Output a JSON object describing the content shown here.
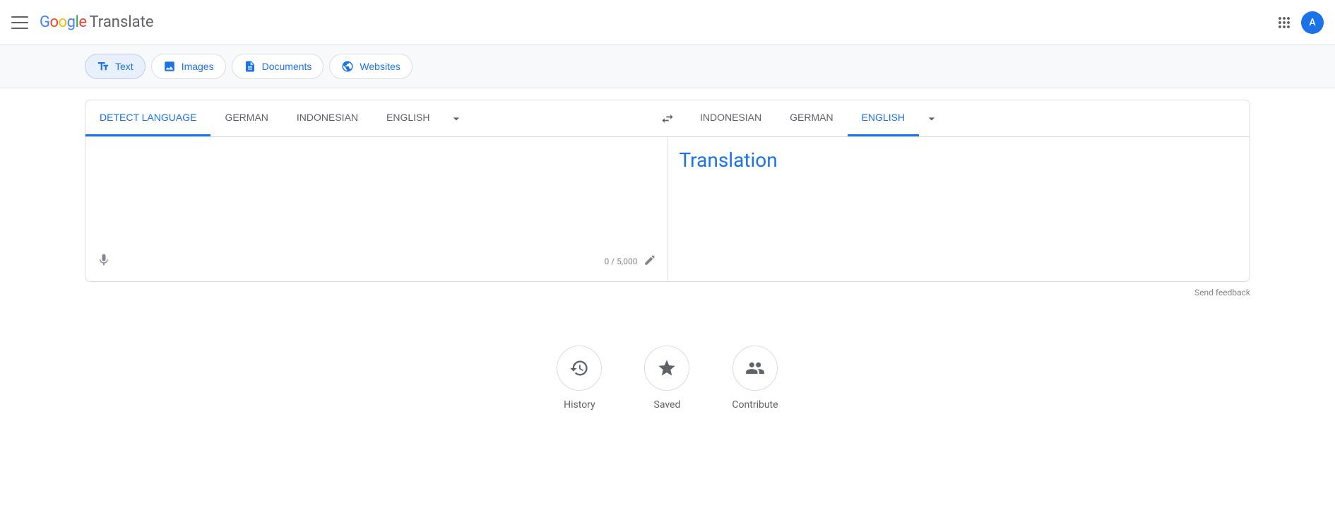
{
  "header": {
    "menu_icon": "hamburger-icon",
    "logo_google": "Google",
    "logo_translate": "Translate",
    "apps_icon": "apps-icon",
    "avatar_letter": "A",
    "title": "Google Translate"
  },
  "toolbar": {
    "tabs": [
      {
        "id": "text",
        "label": "Text",
        "icon": "text-icon",
        "active": true
      },
      {
        "id": "images",
        "label": "Images",
        "icon": "image-icon",
        "active": false
      },
      {
        "id": "documents",
        "label": "Documents",
        "icon": "document-icon",
        "active": false
      },
      {
        "id": "websites",
        "label": "Websites",
        "icon": "website-icon",
        "active": false
      }
    ]
  },
  "source": {
    "languages": [
      {
        "id": "detect",
        "label": "DETECT LANGUAGE",
        "active": true
      },
      {
        "id": "german",
        "label": "GERMAN",
        "active": false
      },
      {
        "id": "indonesian",
        "label": "INDONESIAN",
        "active": false
      },
      {
        "id": "english",
        "label": "ENGLISH",
        "active": false
      }
    ],
    "more_label": "▼",
    "placeholder": "",
    "char_count": "0 / 5,000"
  },
  "target": {
    "languages": [
      {
        "id": "indonesian",
        "label": "INDONESIAN",
        "active": false
      },
      {
        "id": "german",
        "label": "GERMAN",
        "active": false
      },
      {
        "id": "english",
        "label": "ENGLISH",
        "active": true
      }
    ],
    "more_label": "▼",
    "translation_placeholder": "Translation"
  },
  "feedback": {
    "label": "Send feedback"
  },
  "bottom_actions": [
    {
      "id": "history",
      "label": "History",
      "icon": "history-icon"
    },
    {
      "id": "saved",
      "label": "Saved",
      "icon": "saved-icon"
    },
    {
      "id": "contribute",
      "label": "Contribute",
      "icon": "contribute-icon"
    }
  ]
}
